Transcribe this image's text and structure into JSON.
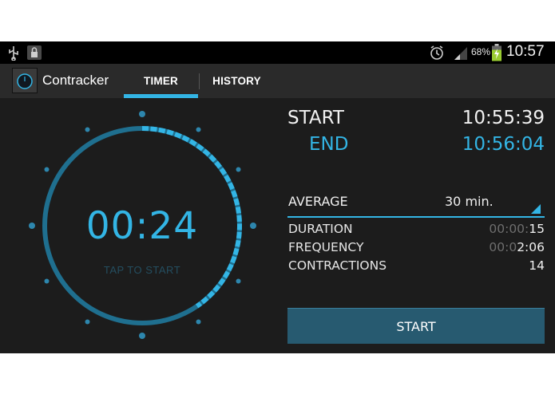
{
  "status_bar": {
    "battery_percent": "68%",
    "time": "10:57",
    "icons": [
      "usb-icon",
      "lock-icon",
      "alarm-icon",
      "signal-icon",
      "battery-charging-icon"
    ]
  },
  "app_bar": {
    "title": "Contracker",
    "tabs": [
      {
        "label": "TIMER",
        "selected": true
      },
      {
        "label": "HISTORY",
        "selected": false
      }
    ],
    "accent_color": "#33b5e5"
  },
  "timer": {
    "elapsed": "00:24",
    "hint": "TAP TO START",
    "progress_fraction": 0.4
  },
  "session": {
    "start_label": "START",
    "start_time": "10:55:39",
    "end_label": "END",
    "end_time": "10:56:04"
  },
  "stats": {
    "average_label": "AVERAGE",
    "average_value": "30 min.",
    "rows": [
      {
        "label": "DURATION",
        "muted": "00:00:",
        "value": "15"
      },
      {
        "label": "FREQUENCY",
        "muted": "00:0",
        "value": "2:06"
      },
      {
        "label": "CONTRACTIONS",
        "muted": "",
        "value": "14"
      }
    ]
  },
  "start_button": {
    "label": "START"
  },
  "colors": {
    "accent": "#33b5e5",
    "ring": "#1f6f8f",
    "button": "#275a70",
    "background": "#1c1c1c"
  }
}
